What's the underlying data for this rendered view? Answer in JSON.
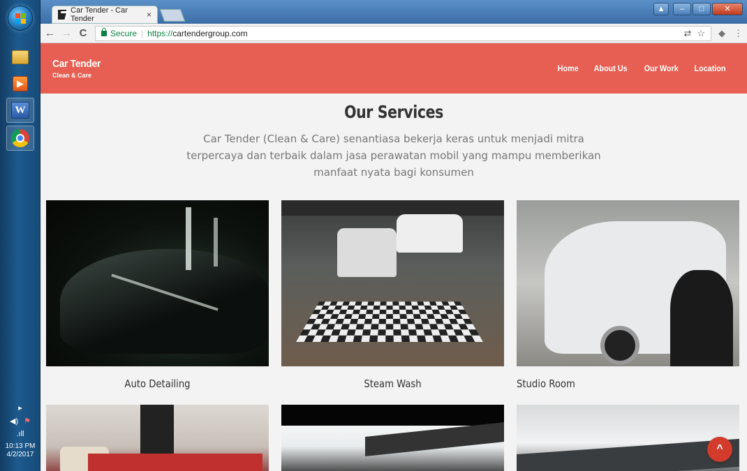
{
  "taskbar": {
    "clock_time": "10:13 PM",
    "clock_date": "4/2/2017",
    "word_letter": "W",
    "expand_glyph": "▸",
    "volume_glyph": "◀)",
    "flag_glyph": "⚑",
    "signal_glyph": ".ıll",
    "icons": [
      "start-orb",
      "windows-explorer-icon",
      "media-player-icon",
      "microsoft-word-icon",
      "google-chrome-icon"
    ]
  },
  "browser": {
    "tab_title": "Car Tender - Car Tender",
    "tab_close": "×",
    "back": "←",
    "forward": "→",
    "reload": "C",
    "secure_label": "Secure",
    "url_scheme": "https://",
    "url_host": "cartendergroup.com",
    "translate_glyph": "⇄",
    "bookmark_glyph": "☆",
    "extension_glyph": "◆",
    "menu_glyph": "⋮",
    "minimize": "–",
    "maximize": "□",
    "close": "✕",
    "user_glyph": "▲"
  },
  "site": {
    "brand": {
      "title": "Car Tender",
      "subtitle": "Clean & Care"
    },
    "menu": [
      {
        "label": "Home"
      },
      {
        "label": "About Us"
      },
      {
        "label": "Our Work"
      },
      {
        "label": "Location"
      }
    ],
    "services": {
      "title": "Our Services",
      "description": "Car Tender (Clean & Care) senantiasa bekerja keras untuk  menjadi mitra terpercaya dan terbaik dalam jasa perawatan mobil yang mampu memberikan manfaat nyata bagi konsumen",
      "items": [
        {
          "title": "Auto Detailing"
        },
        {
          "title": "Steam Wash"
        },
        {
          "title": "Studio Room"
        }
      ]
    },
    "scroll_top_glyph": "^"
  },
  "colors": {
    "header": "#e65f52",
    "page_bg": "#f3f3f3",
    "scroll_button": "#d33b2c"
  }
}
